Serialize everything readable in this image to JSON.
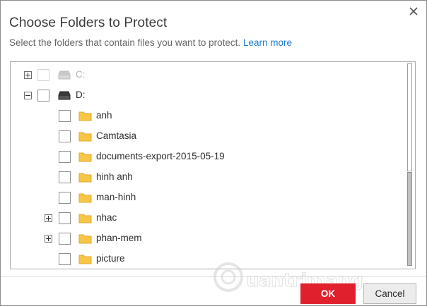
{
  "dialog": {
    "title": "Choose Folders to Protect",
    "subtitle": "Select the folders that contain files you want to protect.",
    "learn_more": "Learn more",
    "close_icon": "close-icon"
  },
  "tree": {
    "drives": [
      {
        "label": "C:",
        "expander": "plus",
        "disabled": true,
        "icon": "drive-icon"
      },
      {
        "label": "D:",
        "expander": "minus",
        "disabled": false,
        "icon": "drive-icon"
      }
    ],
    "folders": [
      {
        "label": "anh",
        "expander": null
      },
      {
        "label": "Camtasia",
        "expander": null
      },
      {
        "label": "documents-export-2015-05-19",
        "expander": null
      },
      {
        "label": "hinh anh",
        "expander": null
      },
      {
        "label": "man-hinh",
        "expander": null
      },
      {
        "label": "nhac",
        "expander": "plus"
      },
      {
        "label": "phan-mem",
        "expander": "plus"
      },
      {
        "label": "picture",
        "expander": null
      }
    ]
  },
  "buttons": {
    "ok": "OK",
    "cancel": "Cancel"
  },
  "colors": {
    "accent": "#e1202d",
    "link": "#1e7bd0",
    "folder": "#f7c646"
  },
  "watermark": {
    "text": "uantrimang"
  }
}
